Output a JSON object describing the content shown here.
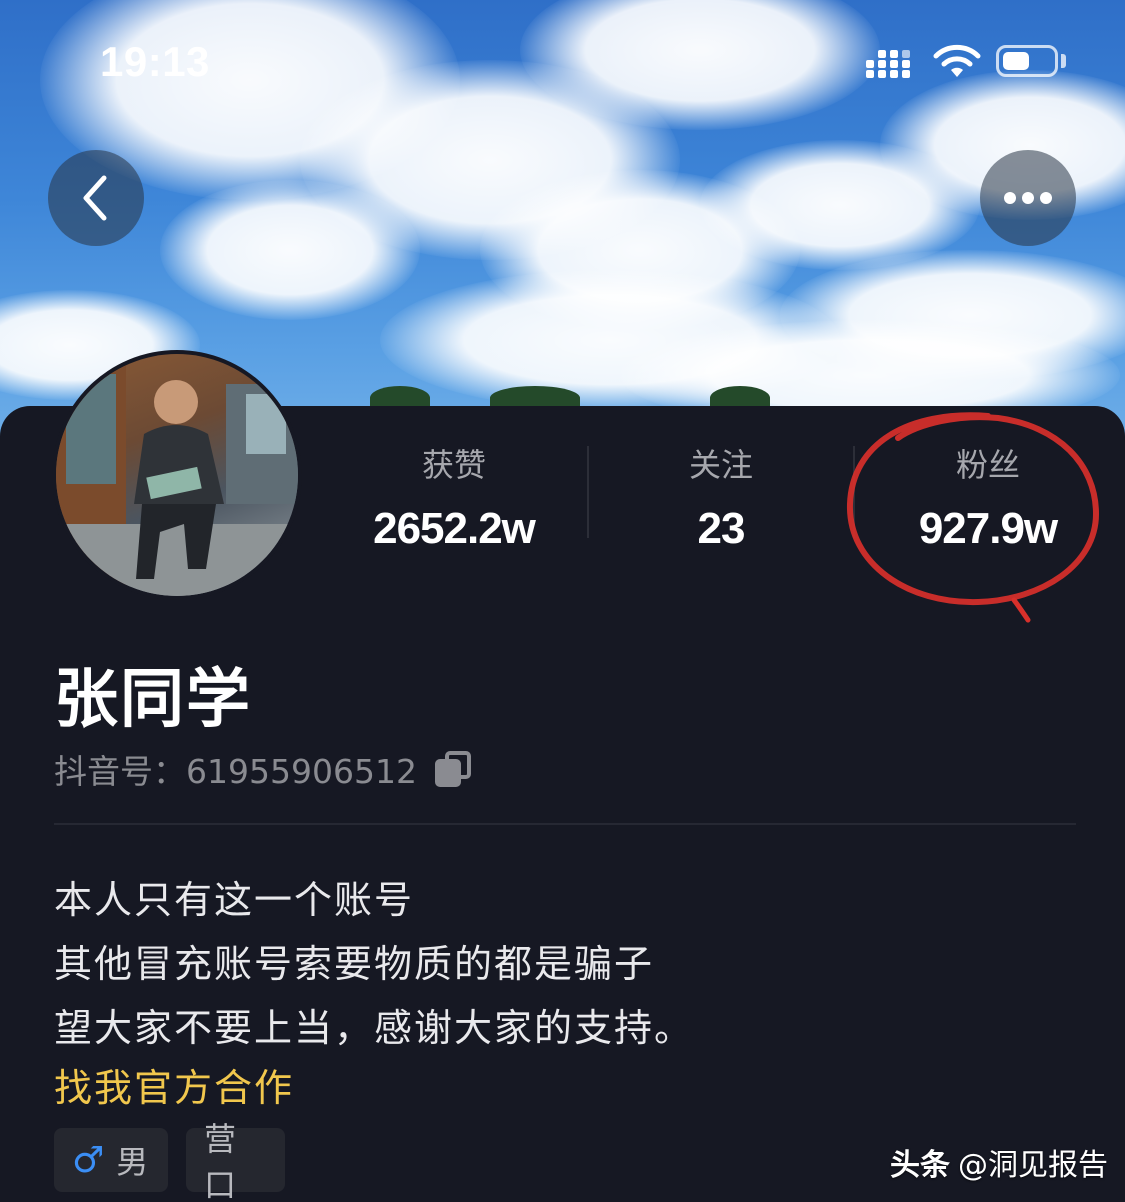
{
  "status_bar": {
    "time": "19:13"
  },
  "nav": {
    "back_icon": "chevron-left-icon",
    "more_icon": "more-horizontal-icon"
  },
  "stats": [
    {
      "label": "获赞",
      "value": "2652.2w"
    },
    {
      "label": "关注",
      "value": "23"
    },
    {
      "label": "粉丝",
      "value": "927.9w"
    }
  ],
  "profile": {
    "nickname": "张同学",
    "douyin_id": "抖音号：61955906512",
    "bio": [
      "本人只有这一个账号",
      "其他冒充账号索要物质的都是骗子",
      "望大家不要上当，感谢大家的支持。"
    ],
    "cooperation_link": "找我官方合作",
    "tags": [
      {
        "icon": "male-icon",
        "label": "男"
      },
      {
        "label": "营口"
      }
    ]
  },
  "watermark": {
    "brand": "头条",
    "handle": "@洞见报告"
  },
  "colors": {
    "background": "#161823",
    "accent_link": "#f1c74d",
    "annotation_circle": "#d8302b",
    "male_icon": "#3b8ef5"
  }
}
